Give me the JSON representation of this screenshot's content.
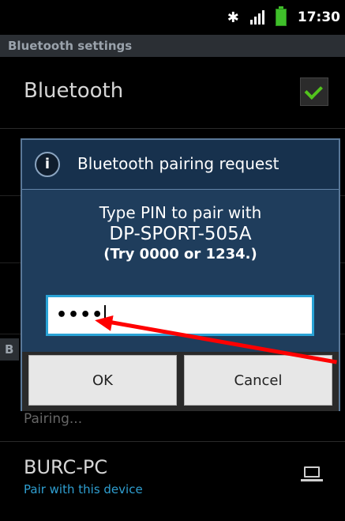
{
  "status_bar": {
    "time": "17:30",
    "icons": [
      "bluetooth-icon",
      "signal-icon",
      "battery-icon"
    ]
  },
  "settings": {
    "section_header": "Bluetooth settings",
    "bluetooth_toggle_label": "Bluetooth",
    "bluetooth_enabled": true,
    "partial_header_letter": "B",
    "pairing_status": "Pairing...",
    "device": {
      "name": "BURC-PC",
      "subtitle": "Pair with this device",
      "icon": "laptop-icon"
    }
  },
  "dialog": {
    "title": "Bluetooth pairing request",
    "icon": "info-icon",
    "message_line1": "Type PIN to pair with",
    "device_name": "DP-SPORT-505A",
    "hint": "(Try 0000 or 1234.)",
    "pin_masked": "••••",
    "ok_label": "OK",
    "cancel_label": "Cancel"
  },
  "colors": {
    "dialog_bg": "#1f3d5c",
    "input_border": "#2aa3d6",
    "check_green": "#52c31d",
    "link_blue": "#2f9fd1",
    "annotation_arrow": "#ff0000"
  }
}
